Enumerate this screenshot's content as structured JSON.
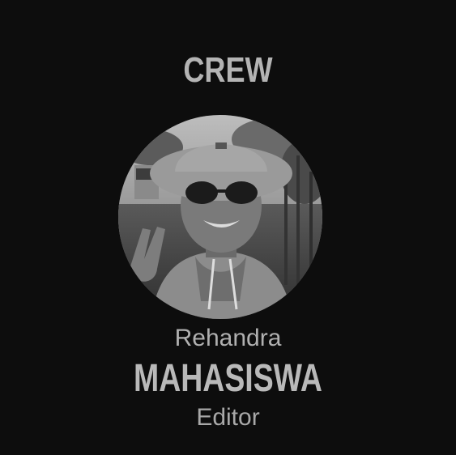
{
  "header": {
    "title": "CREW"
  },
  "profile": {
    "photo_icon": "person-portrait-photo",
    "first_name": "Rehandra",
    "last_name": "MAHASISWA",
    "role": "Editor"
  },
  "colors": {
    "background": "#0d0d0d",
    "text": "#b4b4b4"
  }
}
